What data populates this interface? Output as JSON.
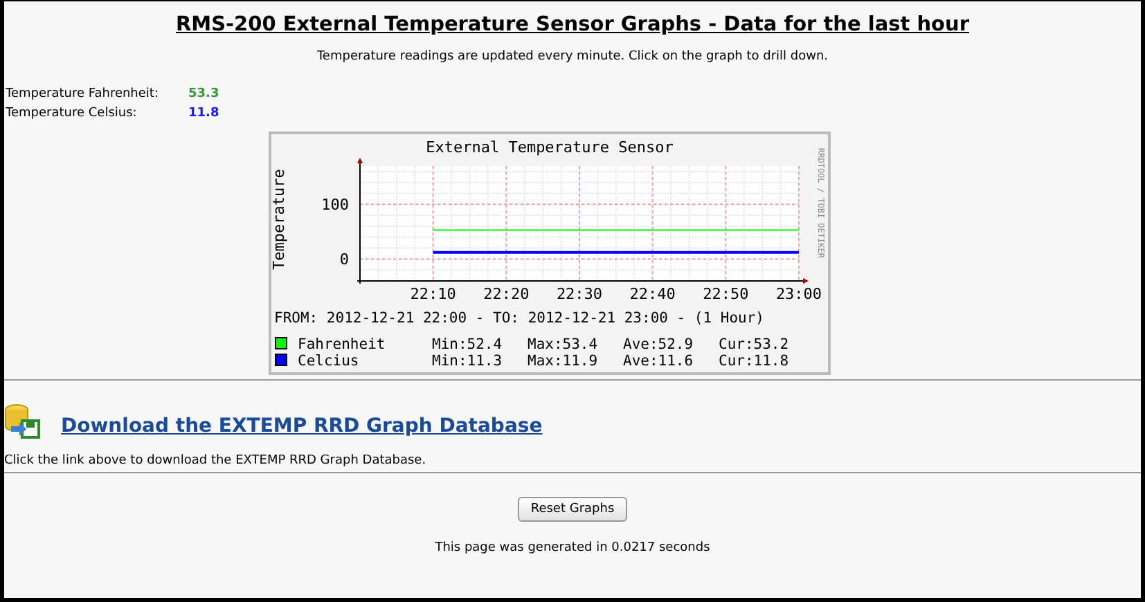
{
  "page": {
    "title": "RMS-200 External Temperature Sensor Graphs - Data for the last hour",
    "subtitle": "Temperature readings are updated every minute. Click on the graph to drill down."
  },
  "readings": [
    {
      "label": "Temperature Fahrenheit:",
      "value": "53.3",
      "color": "#339933"
    },
    {
      "label": "Temperature Celsius:",
      "value": "11.8",
      "color": "#1a1aff"
    }
  ],
  "graph": {
    "credit": "RRDTOOL / TOBI OETIKER",
    "range": "FROM: 2012-12-21 22:00 - TO: 2012-12-21 23:00 - (1 Hour)",
    "legend": [
      {
        "min": "Min:52.4",
        "max": "Max:53.4",
        "ave": "Ave:52.9",
        "cur": "Cur:53.2"
      },
      {
        "min": "Min:11.3",
        "max": "Max:11.9",
        "ave": "Ave:11.6",
        "cur": "Cur:11.8"
      }
    ],
    "chart_data": {
      "type": "line",
      "title": "External Temperature Sensor",
      "ylabel": "Temperature",
      "categories": [
        "22:10",
        "22:20",
        "22:30",
        "22:40",
        "22:50",
        "23:00"
      ],
      "ylim": [
        -40,
        170
      ],
      "yticks": [
        0,
        100
      ],
      "grid": true,
      "legend": true,
      "series": [
        {
          "name": "Fahrenheit",
          "color": "#00ff00",
          "values": [
            53,
            53,
            53,
            53,
            53,
            53
          ]
        },
        {
          "name": "Celcius",
          "color": "#0000ff",
          "values": [
            12,
            12,
            12,
            12,
            12,
            12
          ]
        }
      ]
    }
  },
  "download": {
    "link": "Download the EXTEMP RRD Graph Database",
    "hint": "Click the link above to download the EXTEMP RRD Graph Database."
  },
  "buttons": [
    "Reset Graphs"
  ],
  "footer": "This page was generated in 0.0217 seconds"
}
